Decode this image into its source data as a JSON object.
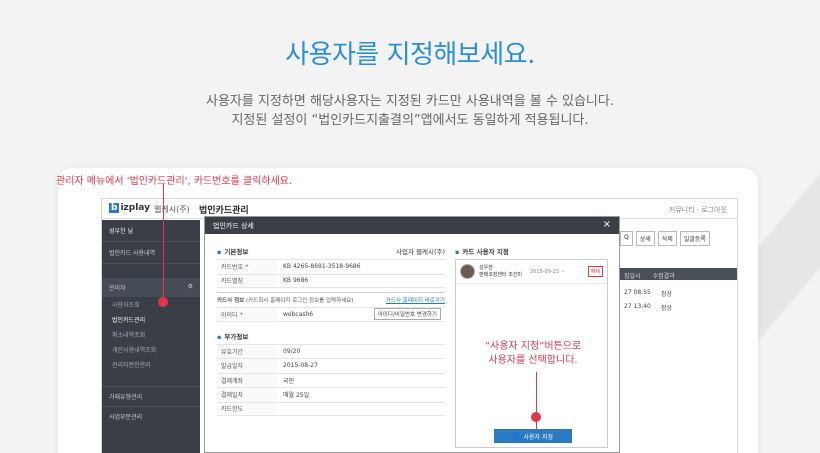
{
  "heading": {
    "title": "사용자를 지정해보세요.",
    "line1": "사용자를 지정하면 해당사용자는 지정된 카드만 사용내역을 볼 수 있습니다.",
    "line2": "지정된 설정이 “법인카드지출결의”앱에서도 동일하게 적용됩니다."
  },
  "callouts": {
    "top": "관리자 메뉴에서 '법인카드관리', 카드번호를 클릭하세요.",
    "mid_line1": "“사용자 지정”버튼으로",
    "mid_line2": "사용자를 선택합니다."
  },
  "app": {
    "logo_mark": "b",
    "logo_text": "izplay",
    "company": "웹케시(주)",
    "title": "법인카드관리",
    "topright": "커뮤니티 · 로그아웃",
    "sidebar": {
      "user": "성우찬 님",
      "menu1": "법인카드 사용내역",
      "admin": "관리자",
      "admin_icon": "gear-icon",
      "subitems": [
        "사용자조회",
        "법인카드관리",
        "취소내역조회",
        "개인사용내역조회",
        "관리자권한관리"
      ],
      "bottom1": "거래유형관리",
      "bottom2": "사업부문관리"
    },
    "right": {
      "btn_search": "Q",
      "btn_detail": "상세",
      "btn_delete": "삭제",
      "btn_bulk": "일괄등록",
      "col1": "집일시",
      "col2": "수집결과",
      "rows": [
        {
          "time": "27 08:55",
          "result": "정상"
        },
        {
          "time": "27 13:40",
          "result": "정상"
        }
      ]
    }
  },
  "modal": {
    "title": "법인카드 상세",
    "close": "×",
    "basic_title": "기본정보",
    "company_label": "사업자 웹케시(주)",
    "card_no_label": "카드번호",
    "card_no": "KB  4265-8691-3518-9686",
    "card_alias_label": "카드별칭",
    "card_alias": "KB 9686",
    "cardco_title": "카드사 정보",
    "cardco_hint": "(카드회사 홈페이지 로그인 정보를 입력하세요)",
    "cardco_link": "카드사 홈페이지 바로가기",
    "id_label": "아이디",
    "id_value": "webcash6",
    "id_button": "아이디/비밀번호 변경하기",
    "extra_title": "부가정보",
    "validity_label": "유효기간",
    "validity": "09/20",
    "issue_label": "발급일자",
    "issue": "2015-08-27",
    "account_label": "결제계좌",
    "account": "국민",
    "payday_label": "결제일자",
    "payday": "매월 25일",
    "limit_label": "카드한도",
    "limit": "",
    "user_title": "카드 사용자 지정",
    "user_name": "성우찬",
    "user_team": "판매코칭센터 조선미",
    "user_date": "2015-09-23 ~",
    "user_remove": "해제",
    "assign_button": "사용자 지정"
  }
}
